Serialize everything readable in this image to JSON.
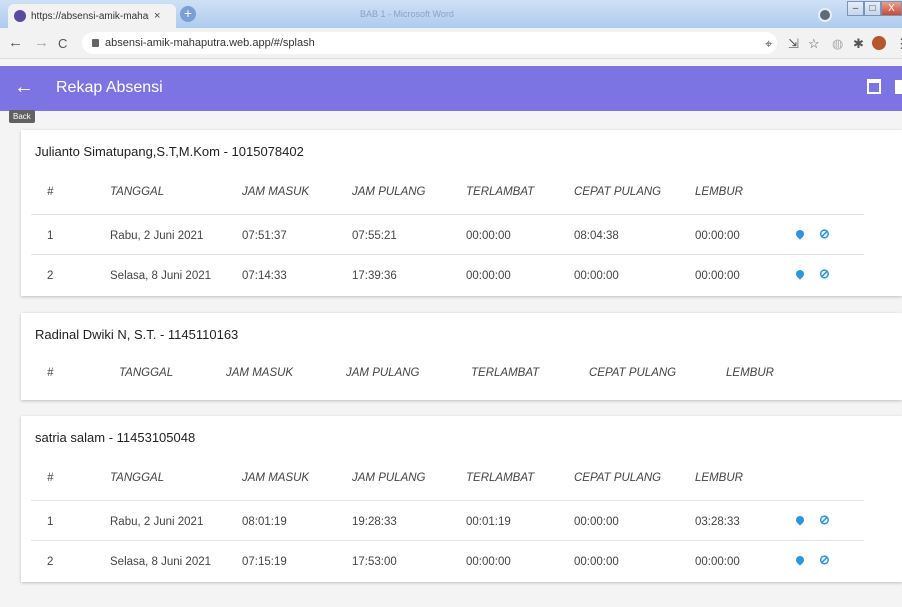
{
  "browser": {
    "tab_title": "https://absensi-amik-mahaputra",
    "tab_close": "×",
    "new_tab": "+",
    "window_title": "BAB 1 - Microsoft Word",
    "url": "absensi-amik-mahaputra.web.app/#/splash",
    "back": "←",
    "forward": "→",
    "reload": "C",
    "min": "–",
    "max": "□",
    "close": "X"
  },
  "appbar": {
    "back_icon": "←",
    "title": "Rekap Absensi",
    "tooltip": "Back"
  },
  "headers": {
    "no": "#",
    "tanggal": "TANGGAL",
    "jam_masuk": "JAM MASUK",
    "jam_pulang": "JAM PULANG",
    "terlambat": "TERLAMBAT",
    "cepat_pulang": "CEPAT PULANG",
    "lembur": "LEMBUR"
  },
  "cards": [
    {
      "title": "Julianto Simatupang,S.T,M.Kom - 1015078402",
      "rows": [
        {
          "no": "1",
          "tanggal": "Rabu, 2 Juni 2021",
          "jam_masuk": "07:51:37",
          "jam_pulang": "07:55:21",
          "terlambat": "00:00:00",
          "cepat_pulang": "08:04:38",
          "lembur": "00:00:00"
        },
        {
          "no": "2",
          "tanggal": "Selasa, 8 Juni 2021",
          "jam_masuk": "07:14:33",
          "jam_pulang": "17:39:36",
          "terlambat": "00:00:00",
          "cepat_pulang": "00:00:00",
          "lembur": "00:00:00"
        }
      ]
    },
    {
      "title": "Radinal Dwiki N, S.T. - 1145110163",
      "rows": []
    },
    {
      "title": "satria salam - 11453105048",
      "rows": [
        {
          "no": "1",
          "tanggal": "Rabu, 2 Juni 2021",
          "jam_masuk": "08:01:19",
          "jam_pulang": "19:28:33",
          "terlambat": "00:01:19",
          "cepat_pulang": "00:00:00",
          "lembur": "03:28:33"
        },
        {
          "no": "2",
          "tanggal": "Selasa, 8 Juni 2021",
          "jam_masuk": "07:15:19",
          "jam_pulang": "17:53:00",
          "terlambat": "00:00:00",
          "cepat_pulang": "00:00:00",
          "lembur": "00:00:00"
        }
      ]
    }
  ],
  "colors": {
    "appbar": "#7d74e3",
    "pin": "#2a96e0"
  },
  "icons": {
    "location": "location-pin-icon",
    "location_off": "location-off-icon",
    "calendar": "calendar-icon",
    "print": "print-icon"
  }
}
